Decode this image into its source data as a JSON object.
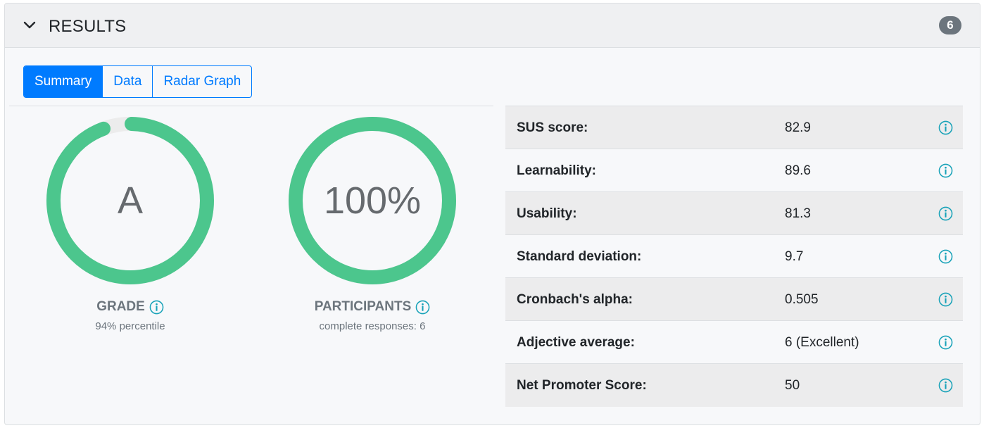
{
  "header": {
    "title": "RESULTS",
    "count": "6"
  },
  "tabs": [
    {
      "label": "Summary",
      "active": true
    },
    {
      "label": "Data",
      "active": false
    },
    {
      "label": "Radar Graph",
      "active": false
    }
  ],
  "gauges": {
    "grade": {
      "value": "A",
      "label": "GRADE",
      "sub": "94% percentile",
      "fill_percent": 94
    },
    "participants": {
      "value": "100%",
      "label": "PARTICIPANTS",
      "sub": "complete responses: 6",
      "fill_percent": 100
    }
  },
  "stats": [
    {
      "label": "SUS score:",
      "value": "82.9"
    },
    {
      "label": "Learnability:",
      "value": "89.6"
    },
    {
      "label": "Usability:",
      "value": "81.3"
    },
    {
      "label": "Standard deviation:",
      "value": "9.7"
    },
    {
      "label": "Cronbach's alpha:",
      "value": "0.505"
    },
    {
      "label": "Adjective average:",
      "value": "6 (Excellent)"
    },
    {
      "label": "Net Promoter Score:",
      "value": "50"
    }
  ],
  "colors": {
    "accent": "#007bff",
    "gauge_fill": "#4cc68d",
    "gauge_track": "#ebebeb",
    "info": "#17a2b8",
    "badge": "#6c757d"
  },
  "icons": {
    "collapse": "chevron-down-icon",
    "info": "info-circle-icon"
  }
}
